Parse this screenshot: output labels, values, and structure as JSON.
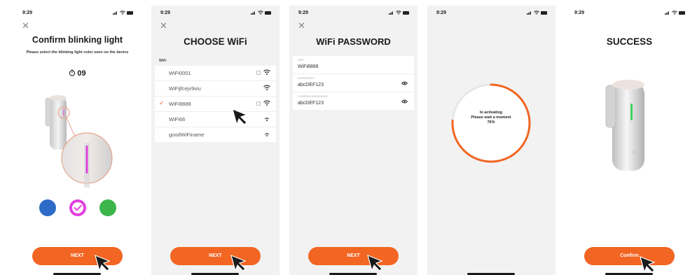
{
  "status": {
    "time": "9:29"
  },
  "screen1": {
    "title": "Confirm blinking light",
    "subtitle": "Please select the blinking light color seen on the device",
    "countdown": "09",
    "colors": [
      "#2d6bc7",
      "#e040e0",
      "#3cb54a"
    ],
    "selected_color_index": 1,
    "button": "NEXT"
  },
  "screen2": {
    "title": "CHOOSE WiFi",
    "section_label": "WiFi",
    "networks": [
      {
        "name": "WiFi0001",
        "locked": true,
        "selected": false
      },
      {
        "name": "WiFijfcejv9viu",
        "locked": false,
        "selected": false
      },
      {
        "name": "WiFi8888",
        "locked": true,
        "selected": true
      },
      {
        "name": "WiFi66",
        "locked": false,
        "selected": false
      },
      {
        "name": "goodWiFiname",
        "locked": false,
        "selected": false
      }
    ],
    "button": "NEXT"
  },
  "screen3": {
    "title": "WiFi PASSWORD",
    "wifi_label": "WIFI",
    "wifi_value": "WiFi8888",
    "password_label": "PASSWORD",
    "password_value": "abcDEF123",
    "confirm_label": "CONFIRM PASSWORD",
    "confirm_value": "abcDEF123",
    "button": "NEXT"
  },
  "screen4": {
    "line1": "In activating",
    "line2": "Please wait a moment",
    "percent": "76%",
    "progress": 0.76
  },
  "screen5": {
    "title": "SUCCESS",
    "button": "Confirm"
  },
  "colors": {
    "accent": "#f26522",
    "progress_track": "#e6e6e6"
  }
}
